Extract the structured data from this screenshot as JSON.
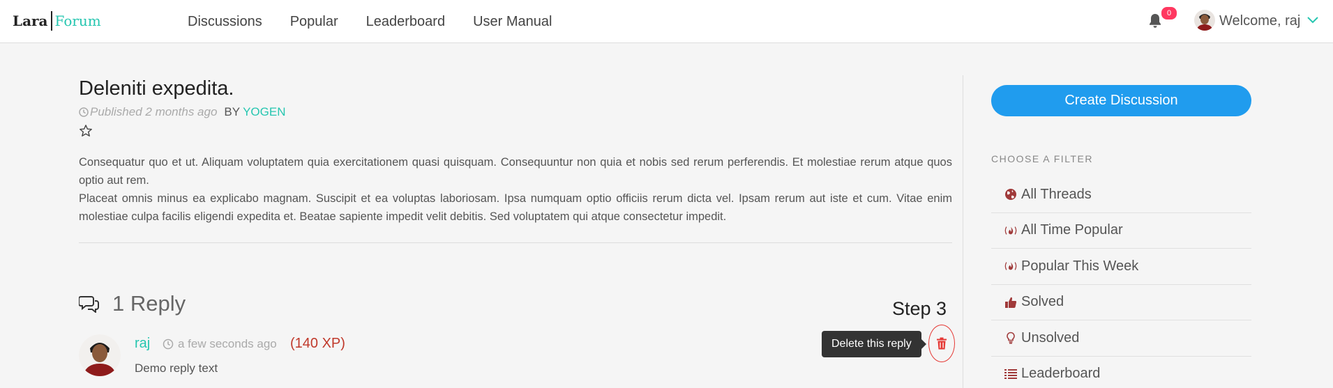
{
  "navbar": {
    "brand": {
      "part1": "Lara",
      "part2": "Forum"
    },
    "links": [
      "Discussions",
      "Popular",
      "Leaderboard",
      "User Manual"
    ],
    "notification_count": "0",
    "welcome": "Welcome, raj"
  },
  "thread": {
    "title": "Deleniti expedita.",
    "published": "Published 2 months ago",
    "by_label": "BY",
    "author": "YOGEN",
    "body": [
      "Consequatur quo et ut. Aliquam voluptatem quia exercitationem quasi quisquam. Consequuntur non quia et nobis sed rerum perferendis. Et molestiae rerum atque quos optio aut rem.",
      "Placeat omnis minus ea explicabo magnam. Suscipit et ea voluptas laboriosam. Ipsa numquam optio officiis rerum dicta vel. Ipsam rerum aut iste et cum. Vitae enim molestiae culpa facilis eligendi expedita et. Beatae sapiente impedit velit debitis. Sed voluptatem qui atque consectetur impedit."
    ]
  },
  "replies": {
    "count_label": "1 Reply",
    "step_label": "Step 3",
    "items": [
      {
        "user": "raj",
        "time": "a few seconds ago",
        "xp": "(140 XP)",
        "text": "Demo reply text",
        "delete_tooltip": "Delete this reply"
      }
    ]
  },
  "sidebar": {
    "create_button": "Create Discussion",
    "filter_heading": "CHOOSE A FILTER",
    "filters": [
      {
        "label": "All Threads",
        "icon": "globe-icon"
      },
      {
        "label": "All Time Popular",
        "icon": "fire-icon"
      },
      {
        "label": "Popular This Week",
        "icon": "fire-icon"
      },
      {
        "label": "Solved",
        "icon": "thumbs-up-icon"
      },
      {
        "label": "Unsolved",
        "icon": "lightbulb-icon"
      },
      {
        "label": "Leaderboard",
        "icon": "list-icon"
      }
    ]
  },
  "colors": {
    "accent": "#26c6b0",
    "primary_button": "#209cee",
    "badge": "#ff3860",
    "danger": "#e53935",
    "xp": "#c0392b",
    "filter_icon": "#a03a3a"
  }
}
